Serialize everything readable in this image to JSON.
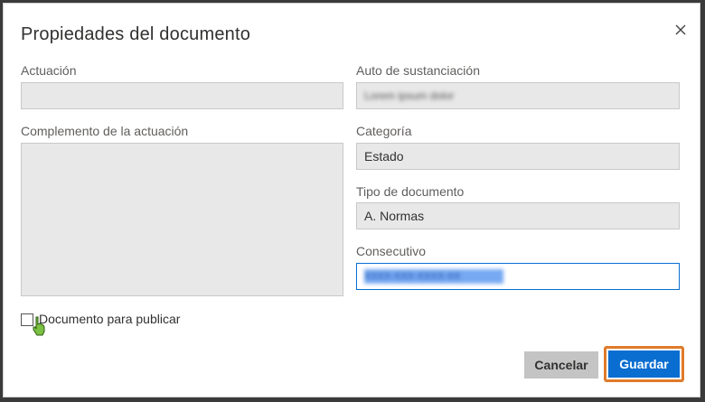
{
  "dialog": {
    "title": "Propiedades del documento",
    "close_icon": "close-icon"
  },
  "left": {
    "actuacion_label": "Actuación",
    "actuacion_value": "",
    "complemento_label": "Complemento de la actuación",
    "complemento_value": ""
  },
  "right": {
    "auto_label": "Auto de sustanciación",
    "auto_value": "Lorem ipsum dolor",
    "categoria_label": "Categoría",
    "categoria_value": "Estado",
    "tipo_label": "Tipo de documento",
    "tipo_value": "A. Normas",
    "consecutivo_label": "Consecutivo",
    "consecutivo_value": "XXXX-XXX-XXXX-XX"
  },
  "checkbox": {
    "label": "Documento para publicar",
    "checked": false
  },
  "buttons": {
    "cancel": "Cancelar",
    "save": "Guardar"
  },
  "colors": {
    "primary": "#0a6ed1",
    "highlight": "#e07b2a",
    "field_bg": "#e8e8e8"
  }
}
